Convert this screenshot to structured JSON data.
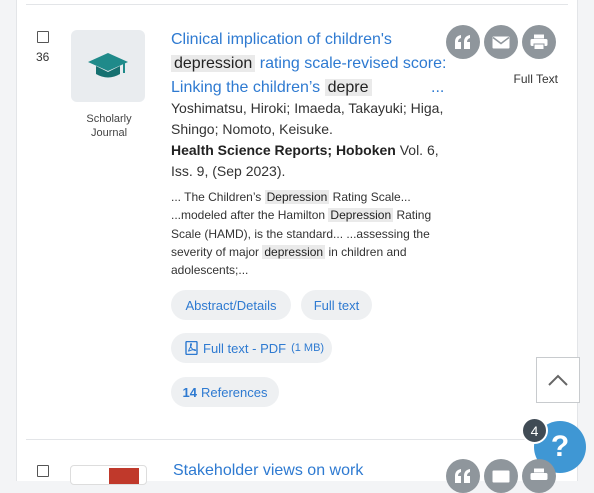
{
  "results": [
    {
      "number": "36",
      "source_type": "Scholarly Journal",
      "title_parts": {
        "t1": "Clinical implication of children's",
        "h1": "depression",
        "t2": "rating scale-revised score: Linking the children’s",
        "h2": "depre",
        "ellipsis": "..."
      },
      "authors": "Yoshimatsu, Hiroki; Imaeda, Takayuki; Higa, Shingo; Nomoto, Keisuke.",
      "journal_name": "Health Science Reports; Hoboken",
      "journal_details": "Vol. 6, Iss. 9,  (Sep 2023).",
      "snippet": {
        "s1": "... The Children’s",
        "h1": "Depression",
        "s2": "Rating Scale... ...modeled after the Hamilton",
        "h2": "Depression",
        "s3": "Rating Scale (HAMD), is the standard... ...assessing the severity of major",
        "h3": "depression",
        "s4": "in children and adolescents;..."
      },
      "links": {
        "abstract": "Abstract/Details",
        "fulltext": "Full text",
        "pdf": "Full text - PDF",
        "pdf_size": "(1 MB)",
        "refs_count": "14",
        "refs_label": "References"
      },
      "actions": {
        "cite": "cite-icon",
        "email": "email-icon",
        "print": "print-icon",
        "fulltext_label": "Full Text"
      }
    },
    {
      "title": "Stakeholder views on work"
    }
  ],
  "help": {
    "badge": "4",
    "symbol": "?"
  },
  "colors": {
    "link": "#2e7ad1",
    "highlight": "#eaeaea",
    "action_icon": "#8f969c",
    "help": "#3f97d4"
  }
}
